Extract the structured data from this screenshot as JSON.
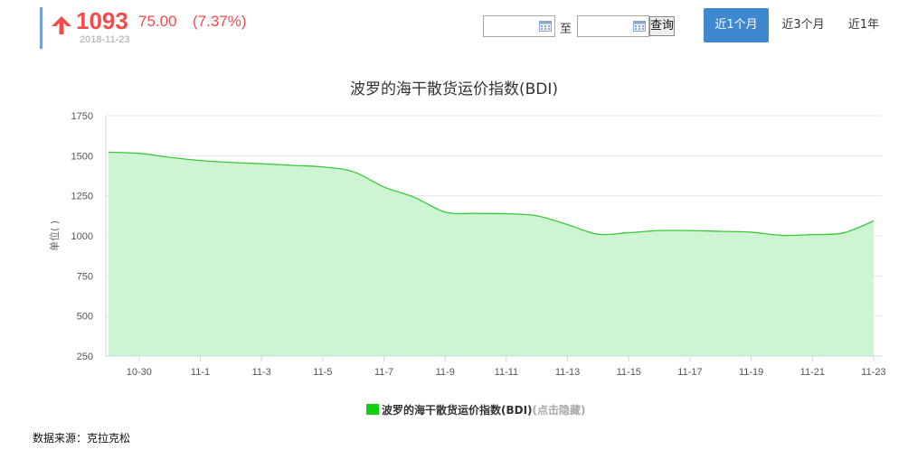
{
  "quote": {
    "price": "1093",
    "change": "75.00",
    "change_pct": "(7.37%)",
    "date": "2018-11-23",
    "direction_icon": "arrow-up-icon",
    "up_color": "#f24b4b"
  },
  "controls": {
    "start_date": "",
    "to_label": "至",
    "end_date": "",
    "query_label": "查询",
    "calendar_icon": "calendar-icon",
    "ranges": [
      {
        "label": "近1个月",
        "active": true
      },
      {
        "label": "近3个月",
        "active": false
      },
      {
        "label": "近1年",
        "active": false
      }
    ]
  },
  "legend": {
    "label": "波罗的海干散货运价指数(BDI)",
    "hint": "(点击隐藏)"
  },
  "source": "数据来源：克拉克松",
  "chart_data": {
    "type": "area",
    "title": "波罗的海干散货运价指数(BDI)",
    "xlabel": "",
    "ylabel": "单位( )",
    "ylim": [
      250,
      1750
    ],
    "yticks": [
      250,
      500,
      750,
      1000,
      1250,
      1500,
      1750
    ],
    "grid": true,
    "legend_position": "bottom",
    "x_tick_labels": [
      "10-30",
      "11-1",
      "11-3",
      "11-5",
      "11-7",
      "11-9",
      "11-11",
      "11-13",
      "11-15",
      "11-17",
      "11-19",
      "11-21",
      "11-23"
    ],
    "series": [
      {
        "name": "波罗的海干散货运价指数(BDI)",
        "color": "#10d010",
        "fill": "#cdf5d1",
        "line": "#3cc73c",
        "x": [
          "10-29",
          "10-30",
          "10-31",
          "11-1",
          "11-2",
          "11-3",
          "11-4",
          "11-5",
          "11-6",
          "11-7",
          "11-8",
          "11-9",
          "11-10",
          "11-11",
          "11-12",
          "11-13",
          "11-14",
          "11-15",
          "11-16",
          "11-17",
          "11-18",
          "11-19",
          "11-20",
          "11-21",
          "11-22",
          "11-23"
        ],
        "values": [
          1522,
          1515,
          1490,
          1470,
          1458,
          1450,
          1440,
          1430,
          1400,
          1305,
          1240,
          1148,
          1140,
          1138,
          1125,
          1070,
          1010,
          1020,
          1033,
          1033,
          1028,
          1023,
          1003,
          1008,
          1018,
          1093
        ]
      }
    ]
  }
}
